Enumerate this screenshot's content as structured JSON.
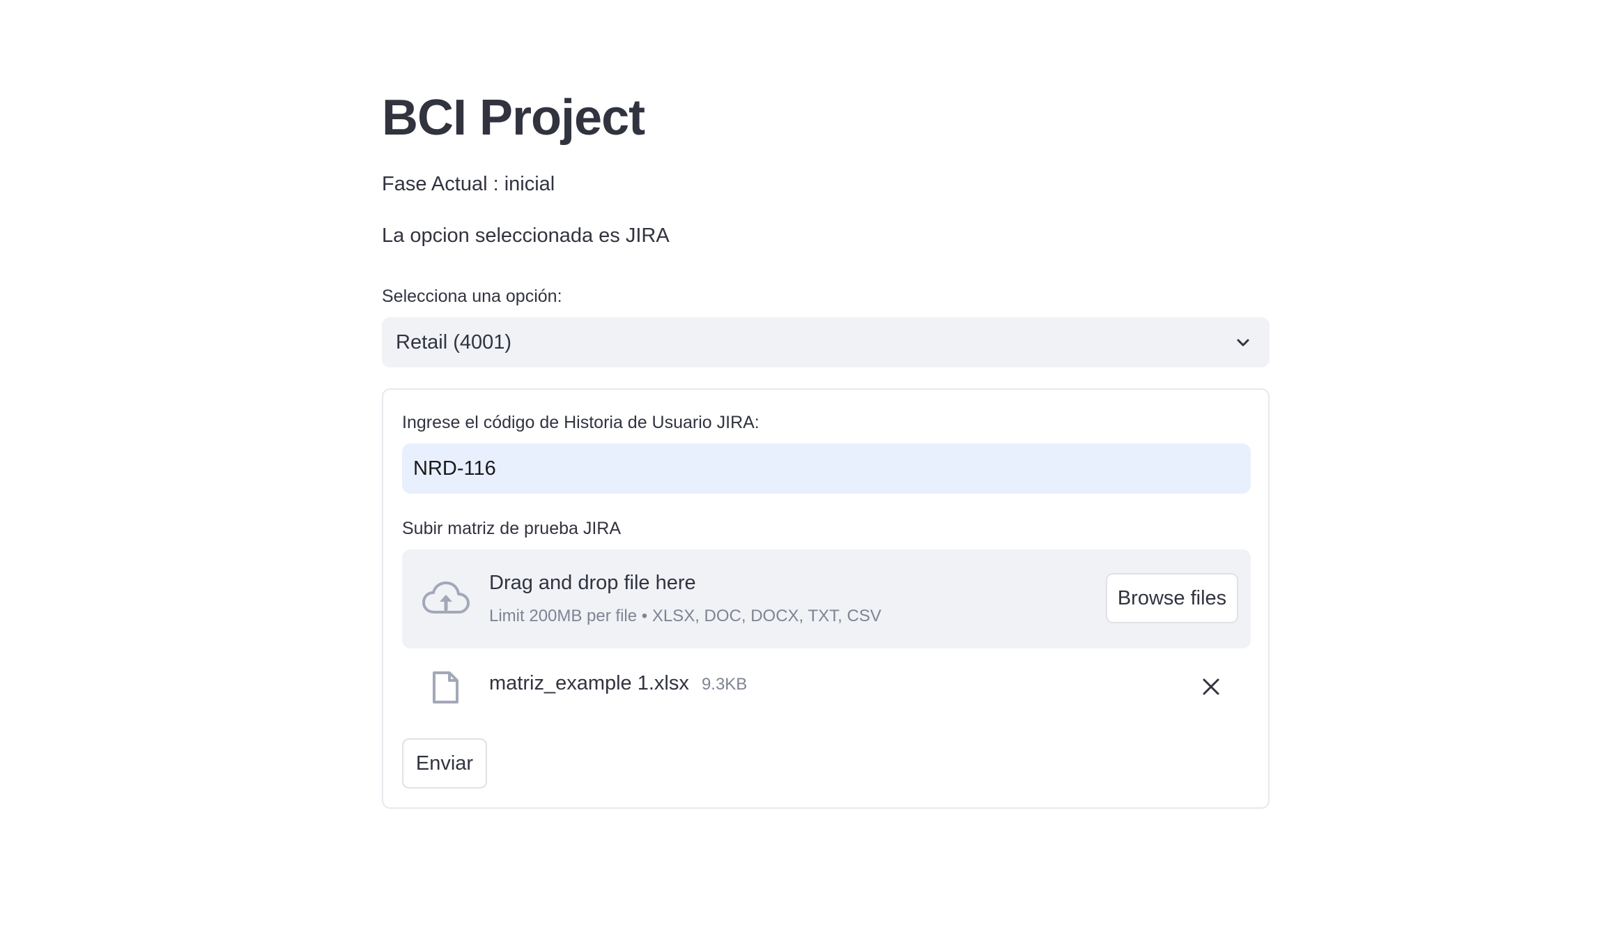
{
  "header": {
    "title": "BCI Project"
  },
  "info": {
    "phase_text": "Fase Actual : inicial",
    "selection_text": "La opcion seleccionada es JIRA"
  },
  "select": {
    "label": "Selecciona una opción:",
    "value": "Retail (4001)"
  },
  "form": {
    "jira_label": "Ingrese el código de Historia de Usuario JIRA:",
    "jira_value": "NRD-116",
    "upload_label": "Subir matriz de prueba JIRA",
    "dropzone_title": "Drag and drop file here",
    "dropzone_limits": "Limit 200MB per file • XLSX, DOC, DOCX, TXT, CSV",
    "browse_label": "Browse files",
    "file_name": "matriz_example 1.xlsx",
    "file_size": "9.3KB",
    "submit_label": "Enviar"
  },
  "colors": {
    "text": "#31333f",
    "muted": "#7f8493",
    "input_bg": "#f0f2f6",
    "autofill_bg": "#e8f0fe",
    "icon": "#a3a8b8"
  },
  "icons": {
    "select_chevron": "chevron-down-icon",
    "upload": "cloud-upload-icon",
    "file": "file-icon",
    "remove": "close-icon"
  }
}
